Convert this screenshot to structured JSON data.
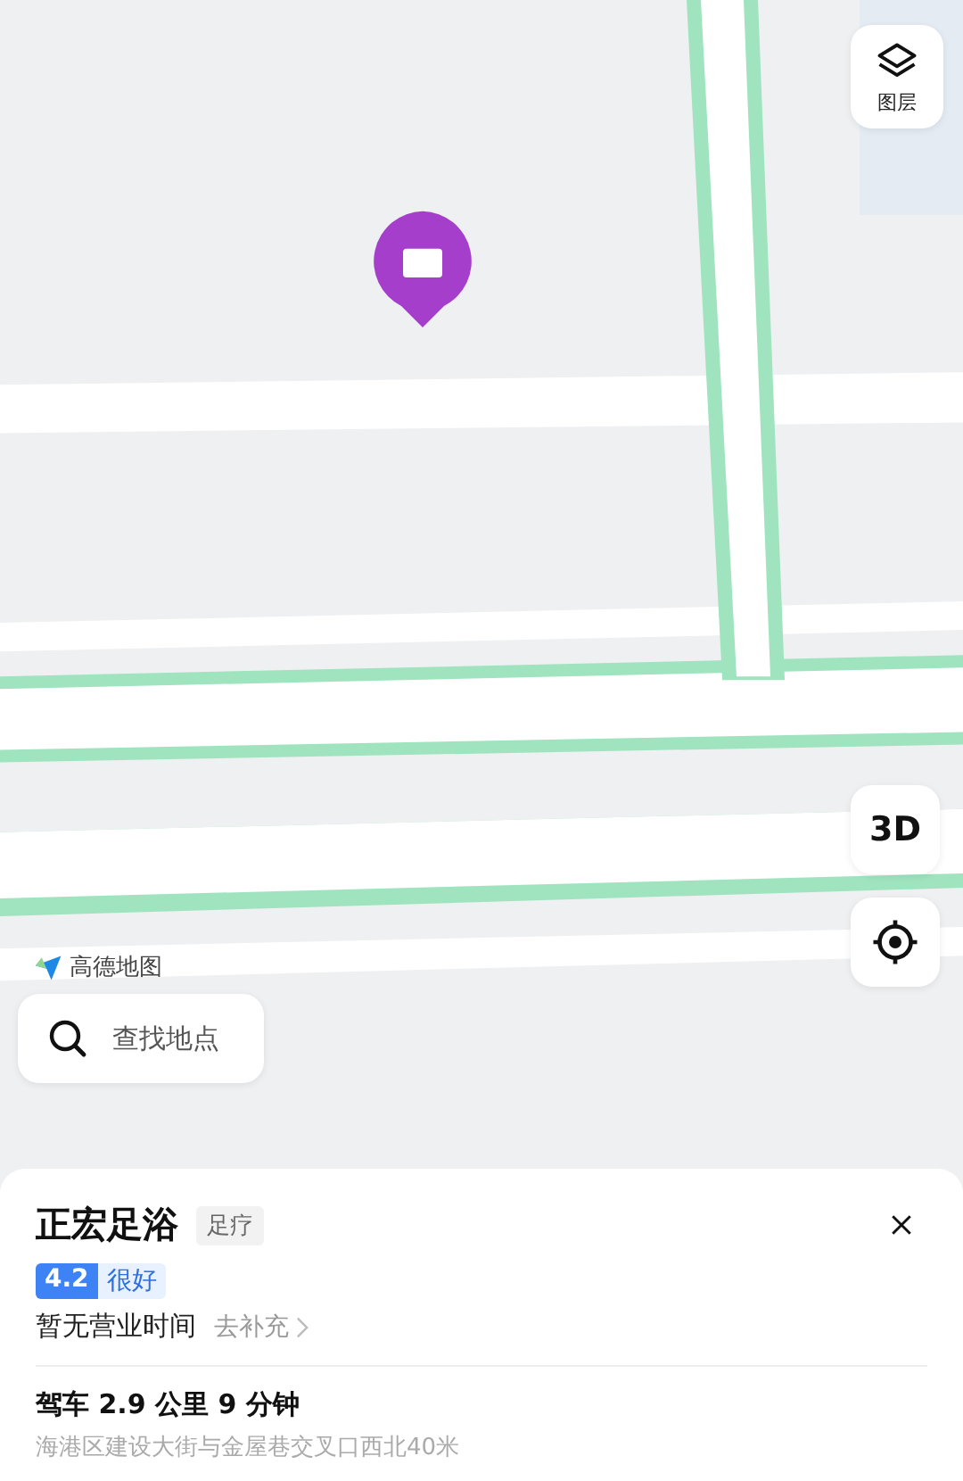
{
  "map": {
    "layers_button": {
      "label": "图层"
    },
    "view_button": {
      "label": "3D"
    },
    "brand": "高德地图",
    "search": {
      "placeholder": "查找地点"
    }
  },
  "place": {
    "name": "正宏足浴",
    "category": "足疗",
    "rating": {
      "score": "4.2",
      "label": "很好"
    },
    "hours": "暂无营业时间",
    "hours_action": "去补充",
    "route": "驾车 2.9 公里 9 分钟",
    "address": "海港区建设大街与金屋巷交叉口西北40米"
  }
}
